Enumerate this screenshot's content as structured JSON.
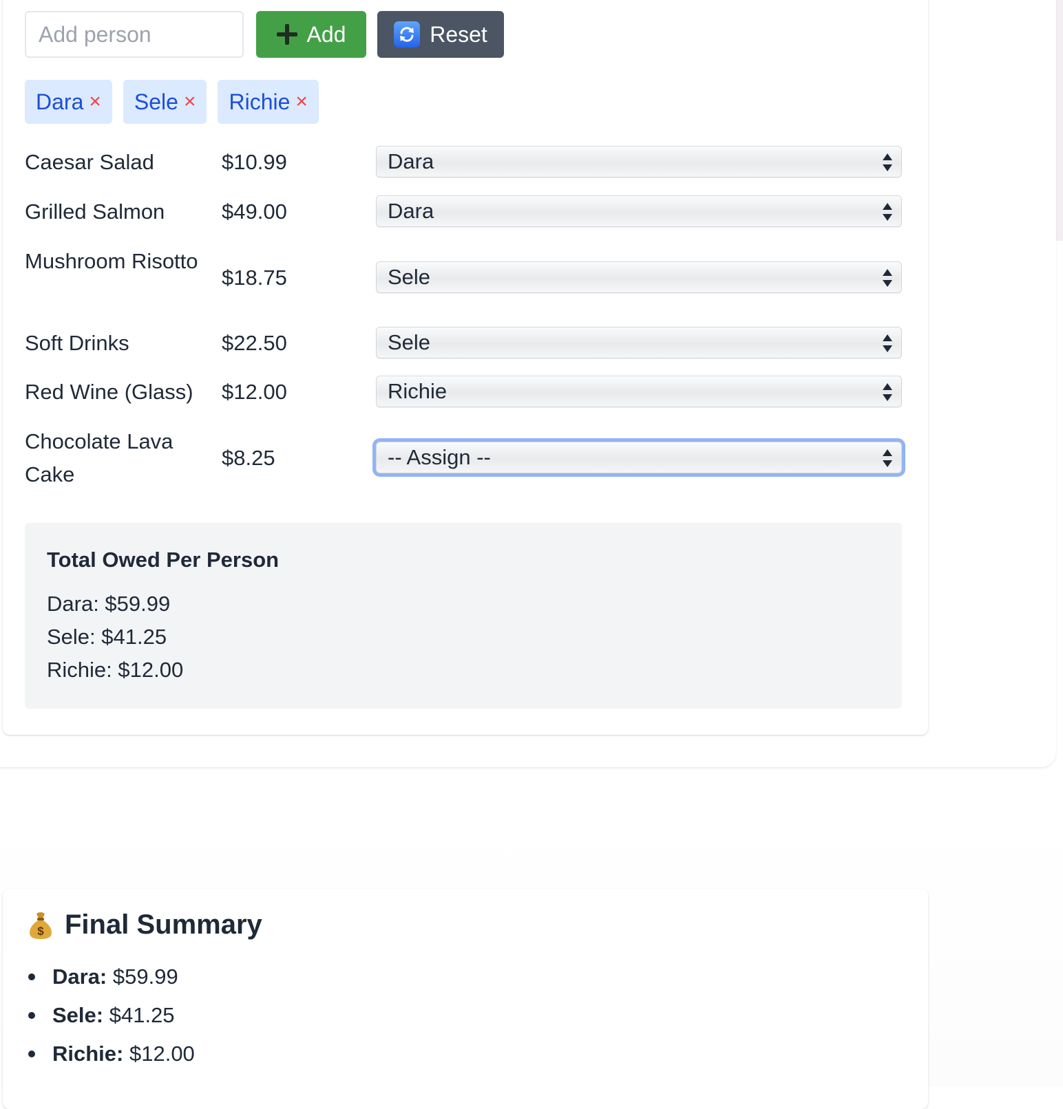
{
  "people_form": {
    "input_placeholder": "Add person",
    "input_value": "",
    "add_label": "Add",
    "reset_label": "Reset"
  },
  "people": [
    {
      "name": "Dara",
      "remove": "×"
    },
    {
      "name": "Sele",
      "remove": "×"
    },
    {
      "name": "Richie",
      "remove": "×"
    }
  ],
  "items": [
    {
      "name": "Caesar Salad",
      "price": "$10.99",
      "assigned": "Dara"
    },
    {
      "name": "Grilled Salmon",
      "price": "$49.00",
      "assigned": "Dara"
    },
    {
      "name": "Mushroom Risotto",
      "price": "$18.75",
      "assigned": "Sele"
    },
    {
      "name": "Soft Drinks",
      "price": "$22.50",
      "assigned": "Sele"
    },
    {
      "name": "Red Wine (Glass)",
      "price": "$12.00",
      "assigned": "Richie"
    },
    {
      "name": "Chocolate Lava Cake",
      "price": "$8.25",
      "assigned": "-- Assign --"
    }
  ],
  "totals": {
    "title": "Total Owed Per Person",
    "lines": [
      "Dara: $59.99",
      "Sele: $41.25",
      "Richie: $12.00"
    ]
  },
  "summary": {
    "title": "Final Summary",
    "icon": "money-bag-icon",
    "items": [
      {
        "name": "Dara:",
        "amount": "$59.99"
      },
      {
        "name": "Sele:",
        "amount": "$41.25"
      },
      {
        "name": "Richie:",
        "amount": "$12.00"
      }
    ]
  },
  "colors": {
    "add_button": "#43a047",
    "reset_button": "#4b5563",
    "tag_bg": "#dbeafe",
    "tag_text": "#1d4ed8",
    "tag_remove": "#ef4444",
    "focus_ring": "#93b4f4",
    "panel_bg": "#f3f4f6"
  }
}
